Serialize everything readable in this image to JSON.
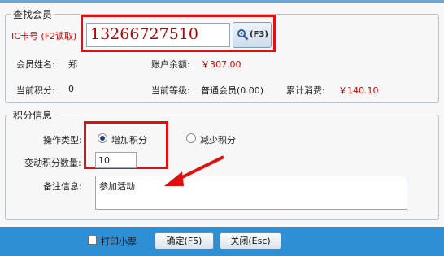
{
  "member_search": {
    "legend": "查找会员",
    "card_label": "IC卡号 (F2读取)",
    "card_value": "13266727510",
    "search_button_label": "(F3)",
    "name_label": "会员姓名:",
    "name_value": "郑",
    "balance_label": "账户余额:",
    "balance_value": "￥307.00",
    "points_label": "当前积分:",
    "points_value": "0",
    "level_label": "当前等级:",
    "level_value": "普通会员(0.00)",
    "total_label": "累计消费:",
    "total_value": "￥140.10"
  },
  "points_info": {
    "legend": "积分信息",
    "operation_label": "操作类型:",
    "add_option": "增加积分",
    "reduce_option": "减少积分",
    "selected": "add",
    "amount_label": "变动积分数量:",
    "amount_value": "10",
    "remark_label": "备注信息:",
    "remark_value": "参加活动"
  },
  "footer": {
    "print_label": "打印小票",
    "confirm_label": "确定(F5)",
    "close_label": "关闭(Esc)"
  },
  "colors": {
    "highlight_red": "#e01010",
    "money_red": "#d40000",
    "footer_blue": "#2f8fd4"
  },
  "icons": [
    "search-icon",
    "arrow-annotation-icon"
  ]
}
